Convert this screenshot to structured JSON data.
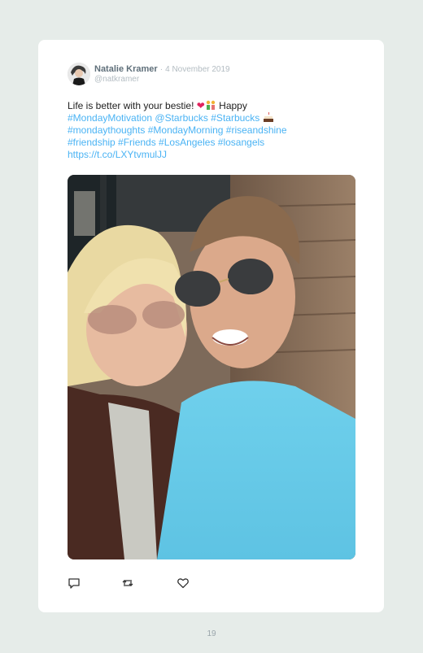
{
  "tweet": {
    "author_name": "Natalie Kramer",
    "separator": "·",
    "date": "4 November 2019",
    "handle": "@natkramer",
    "text_intro": "Life is better with your bestie!",
    "text_happy": "Happy",
    "links_line1": "#MondayMotivation @Starbucks #Starbucks",
    "links_line2": "#mondaythoughts #MondayMorning #riseandshine",
    "links_line3": "#friendship #Friends #LosAngeles #losangels",
    "links_line4": "https://t.co/LXYtvmulJJ"
  },
  "actions": {
    "reply_icon": "reply-icon",
    "retweet_icon": "retweet-icon",
    "like_icon": "heart-icon"
  },
  "page": {
    "number": "19"
  },
  "colors": {
    "link": "#4ab3f4",
    "background": "#e6ece9",
    "card": "#ffffff"
  }
}
